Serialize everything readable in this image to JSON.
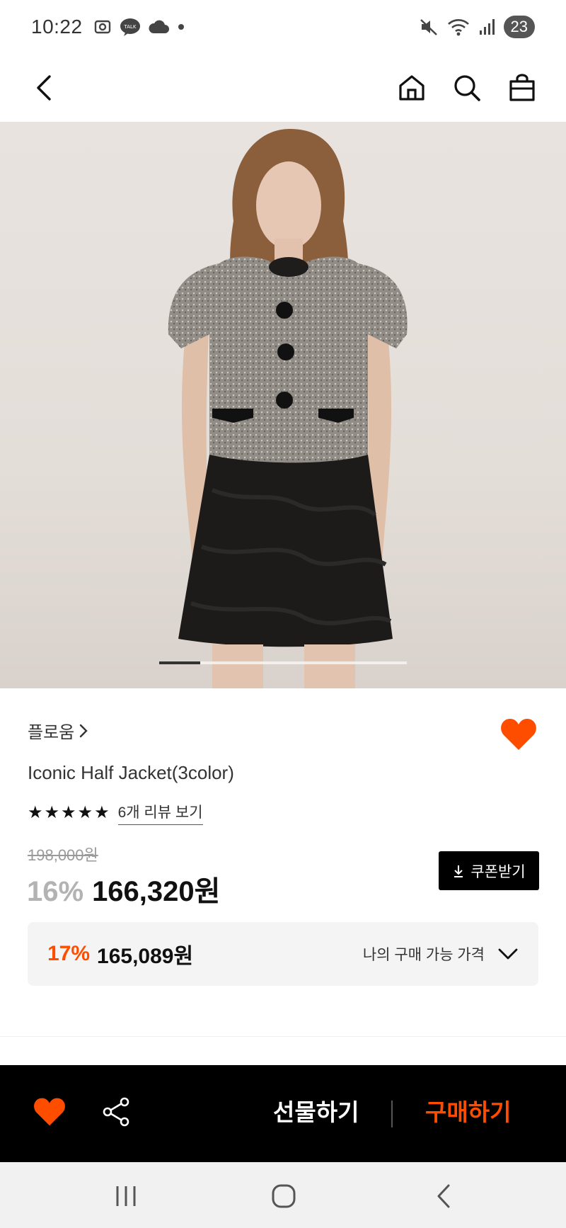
{
  "status_bar": {
    "time": "10:22",
    "battery": "23",
    "left_icons": [
      "screenshot-icon",
      "kakaotalk-icon",
      "cloud-icon",
      "dot-icon"
    ],
    "right_icons": [
      "mute-icon",
      "wifi-icon",
      "signal-icon"
    ]
  },
  "nav": {
    "back_icon": "chevron-left-icon",
    "actions": [
      "home-icon",
      "search-icon",
      "shopping-bag-icon"
    ]
  },
  "gallery": {
    "current_index": 1,
    "total": 6
  },
  "product": {
    "brand": "플로움",
    "name": "Iconic Half Jacket(3color)",
    "rating_stars": 5,
    "review_link": "6개 리뷰 보기",
    "original_price": "198,000원",
    "discount_rate": "16%",
    "sale_price": "166,320원",
    "coupon_label": "쿠폰받기",
    "wishlisted": true
  },
  "best_price": {
    "discount_rate": "17%",
    "price": "165,089원",
    "label": "나의 구매 가능 가격"
  },
  "action_bar": {
    "gift_label": "선물하기",
    "buy_label": "구매하기"
  },
  "colors": {
    "accent": "#ff4d00",
    "black": "#000000",
    "muted": "#b3b3b3"
  }
}
